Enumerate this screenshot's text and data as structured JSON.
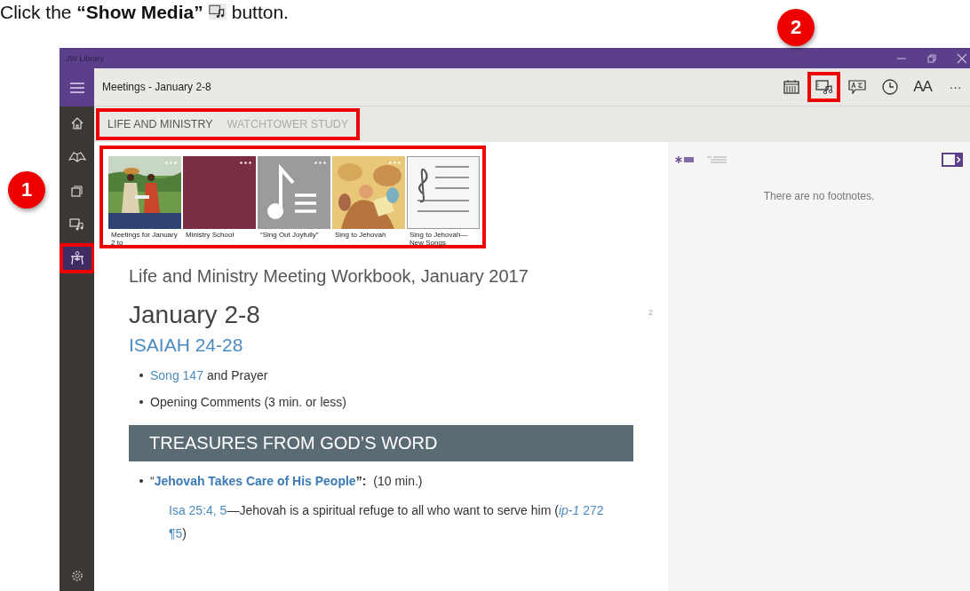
{
  "instruction": {
    "text": "Click the **“Show Media”**",
    "after": "button."
  },
  "annotations": [
    {
      "number": "1"
    },
    {
      "number": "2"
    }
  ],
  "window": {
    "title": "JW Library"
  },
  "sidebar": {
    "items": [
      {
        "kind": "home",
        "selected": false,
        "highlighted": false
      },
      {
        "kind": "book",
        "selected": false,
        "highlighted": false
      },
      {
        "kind": "pages",
        "selected": false,
        "highlighted": false
      },
      {
        "kind": "media",
        "selected": false,
        "highlighted": false
      },
      {
        "kind": "meetings",
        "selected": true,
        "highlighted": true
      }
    ]
  },
  "toolbar": {
    "title": "Meetings - January 2-8",
    "buttons": [
      {
        "kind": "calendar",
        "highlighted": false
      },
      {
        "kind": "media",
        "highlighted": true
      },
      {
        "kind": "language",
        "highlighted": false
      },
      {
        "kind": "history",
        "highlighted": false
      },
      {
        "kind": "text-size",
        "label": "AA",
        "highlighted": false
      },
      {
        "kind": "more",
        "label": "···",
        "highlighted": false
      }
    ]
  },
  "tabs": {
    "highlighted": true,
    "items": [
      {
        "label": "LIFE AND MINISTRY",
        "selected": true
      },
      {
        "label": "WATCHTOWER STUDY",
        "selected": false
      }
    ]
  },
  "media": {
    "highlighted": true,
    "items": [
      {
        "caption": "Meetings for January 2 to"
      },
      {
        "kind": "cover",
        "color": "#7a2e42",
        "caption": "Ministry School"
      },
      {
        "kind": "note",
        "caption": "“Sing Out Joyfully”"
      },
      {
        "kind": "painting",
        "caption": "Sing to Jehovah"
      },
      {
        "kind": "staff",
        "caption": "Sing to Jehovah—New Songs"
      }
    ]
  },
  "article": {
    "title": "Life and Ministry Meeting Workbook, January 2017",
    "page": "2",
    "heading": "January 2-8",
    "subheading": "ISAIAH 24-28",
    "bullets": [
      {
        "parts": [
          {
            "kind": "link",
            "text": "Song 147"
          },
          {
            "kind": "text",
            "text": "and Prayer"
          }
        ]
      },
      {
        "parts": [
          {
            "kind": "text",
            "text": "Opening Comments (3 min. or less)"
          }
        ]
      }
    ],
    "banner": "TREASURES FROM GOD’S WORD",
    "talk": {
      "parts": [
        {
          "kind": "text",
          "text": "“"
        },
        {
          "kind": "bold-link",
          "text": "Jehovah Takes Care of His People"
        },
        {
          "kind": "bold-text",
          "text": "”:"
        },
        {
          "kind": "text",
          "text": "(10 min.)"
        }
      ]
    },
    "paragraph": [
      {
        "kind": "link",
        "text": "Isa 25:4, 5"
      },
      {
        "kind": "text",
        "text": "—Jehovah is a spiritual refuge to all who want to serve him ("
      },
      {
        "kind": "italic-link",
        "text": "ip-1",
        "space_after": true
      },
      {
        "kind": "link",
        "text": "272",
        "space_after": true
      },
      {
        "kind": "link",
        "text": "¶5"
      },
      {
        "kind": "text",
        "text": ")"
      }
    ]
  },
  "footnotes": {
    "tabs": [
      {
        "kind": "footnotes",
        "selected": true
      },
      {
        "kind": "references",
        "selected": false
      }
    ],
    "message": "There are no footnotes."
  }
}
